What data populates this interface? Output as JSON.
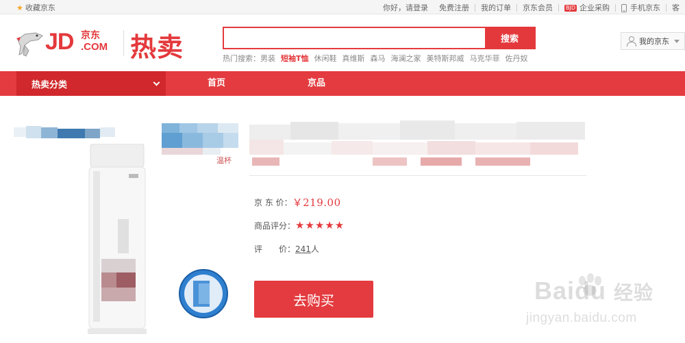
{
  "topbar": {
    "favorite_label": "收藏京东",
    "links": [
      "你好，请登录",
      "免费注册",
      "我的订单",
      "京东会员",
      "企业采购",
      "手机京东",
      "客"
    ],
    "bjd_badge": "BJD"
  },
  "header": {
    "logo_jd": "JD",
    "logo_cn": "京东",
    "logo_com": ".COM",
    "channel_title": "热卖",
    "search_placeholder": "",
    "search_button": "搜索",
    "hot_label": "热门搜索：",
    "hot_terms": [
      "男装",
      "短袖T恤",
      "休闲鞋",
      "真维斯",
      "森马",
      "海澜之家",
      "美特斯邦威",
      "马克华菲",
      "佐丹奴"
    ],
    "hot_highlight_index": 1,
    "my_jd": "我的京东"
  },
  "nav": {
    "category": "热卖分类",
    "items": [
      "首页",
      "京品"
    ]
  },
  "product": {
    "price_label": "京 东 价：",
    "price": "￥219.00",
    "rating_label": "商品评分：",
    "stars": "★★★★★",
    "rating_value": 5,
    "review_label": "评　　价：",
    "review_count": "241",
    "review_unit": "人",
    "thumb_caption": "温杯",
    "buy_button": "去购买"
  },
  "watermark": {
    "text_latin": "Bai",
    "text_mid": "du",
    "text_cn": "经验",
    "url": "jingyan.baidu.com"
  },
  "colors": {
    "brand_red": "#e4393c",
    "nav_red": "#e33b3f",
    "category_red": "#d0282c"
  }
}
